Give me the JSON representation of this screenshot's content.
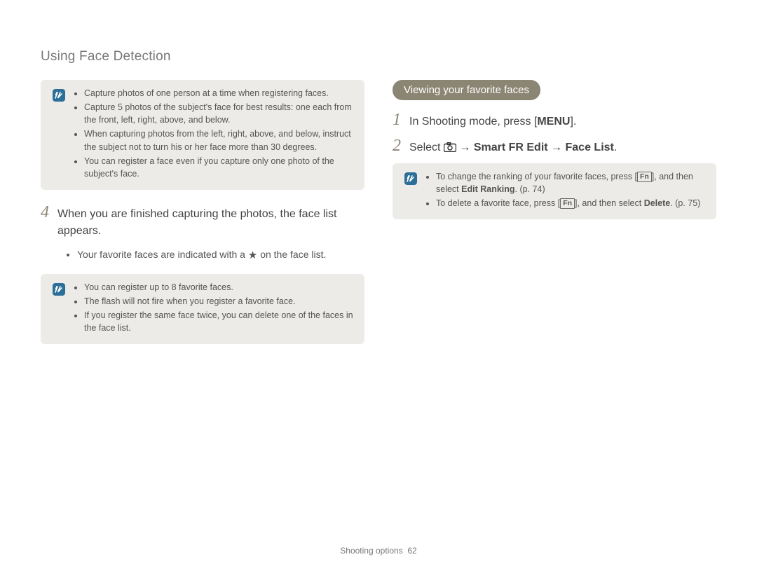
{
  "title": "Using Face Detection",
  "left": {
    "note1": {
      "items": [
        "Capture photos of one person at a time when registering faces.",
        "Capture 5 photos of the subject's face for best results: one each from the front, left, right, above, and below.",
        "When capturing photos from the left, right, above, and below, instruct the subject not to turn his or her face more than 30 degrees.",
        "You can register a face even if you capture only one photo of the subject's face."
      ]
    },
    "step4": {
      "num": "4",
      "text": "When you are finished capturing the photos, the face list appears."
    },
    "sub_prefix": "Your favorite faces are indicated with a ",
    "sub_suffix": " on the face list.",
    "note2": {
      "items": [
        "You can register up to 8 favorite faces.",
        "The flash will not fire when you register a favorite face.",
        "If you register the same face twice, you can delete one of the faces in the face list."
      ]
    }
  },
  "right": {
    "heading": "Viewing your favorite faces",
    "step1": {
      "num": "1",
      "prefix": "In Shooting mode, press [",
      "menu": "MENU",
      "suffix": "]."
    },
    "step2": {
      "num": "2",
      "prefix": "Select ",
      "arrow1": " → ",
      "bold1": "Smart FR Edit",
      "arrow2": " → ",
      "bold2": "Face List",
      "suffix": "."
    },
    "note": {
      "item1_prefix": "To change the ranking of your favorite faces, press [",
      "item1_key": "Fn",
      "item1_mid": "], and then select ",
      "item1_bold": "Edit Ranking",
      "item1_suffix": ". (p. 74)",
      "item2_prefix": "To delete a favorite face, press [",
      "item2_key": "Fn",
      "item2_mid": "], and then select ",
      "item2_bold": "Delete",
      "item2_suffix": ". (p. 75)"
    }
  },
  "footer_section": "Shooting options",
  "footer_page": "62"
}
